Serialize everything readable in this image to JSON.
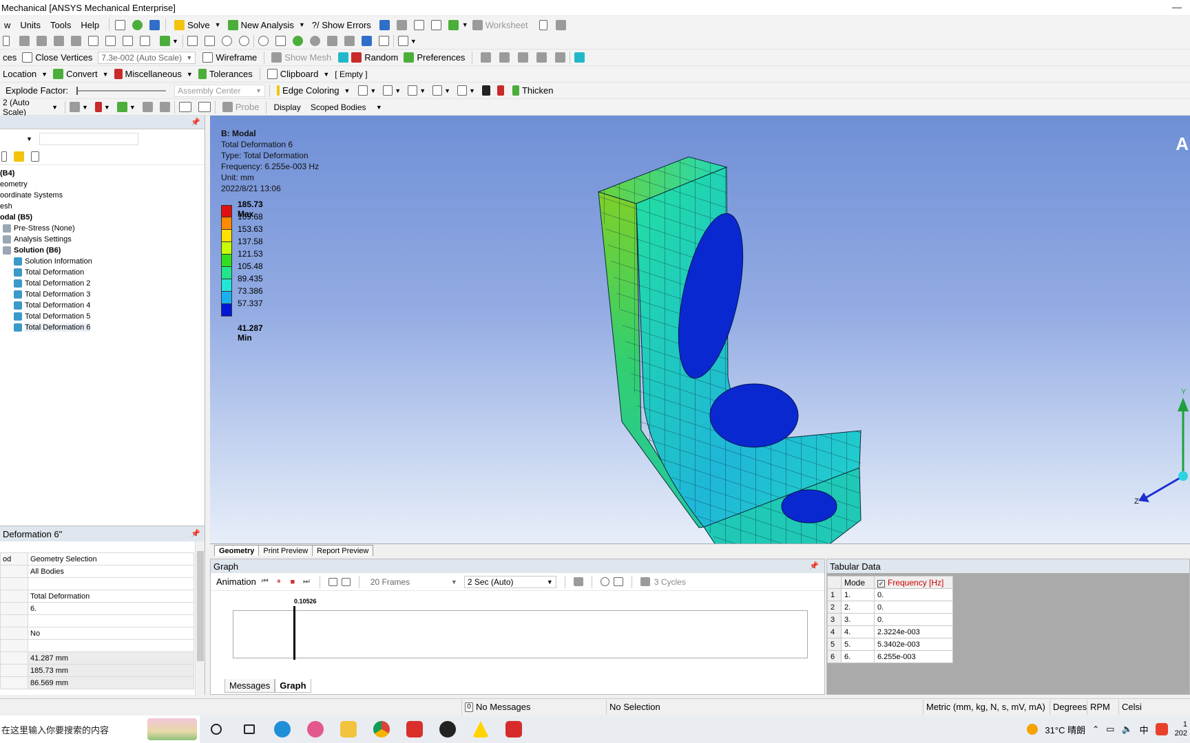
{
  "window": {
    "title": "Mechanical [ANSYS Mechanical Enterprise]",
    "minimize": "—"
  },
  "menu": {
    "items": [
      "w",
      "Units",
      "Tools",
      "Help"
    ],
    "solve": "Solve",
    "new_analysis": "New Analysis",
    "show_errors": "?/ Show Errors",
    "worksheet": "Worksheet"
  },
  "toolbar3": {
    "ces": "ces",
    "close_vertices": "Close Vertices",
    "scale": "7.3e-002 (Auto Scale)",
    "wireframe": "Wireframe",
    "show_mesh": "Show Mesh",
    "random": "Random",
    "preferences": "Preferences"
  },
  "toolbar4": {
    "location": "Location",
    "convert": "Convert",
    "miscellaneous": "Miscellaneous",
    "tolerances": "Tolerances",
    "clipboard": "Clipboard",
    "empty": "[ Empty ]"
  },
  "toolbar5": {
    "explode_factor": "Explode Factor:",
    "assembly_center": "Assembly Center",
    "edge_coloring": "Edge Coloring",
    "thicken": "Thicken"
  },
  "toolbar6": {
    "auto_scale": "2 (Auto Scale)",
    "probe": "Probe",
    "display": "Display",
    "scoped_bodies": "Scoped Bodies"
  },
  "tree": {
    "items": [
      {
        "label": "(B4)",
        "bold": true,
        "indent": 0
      },
      {
        "label": "eometry",
        "bold": false,
        "indent": 0
      },
      {
        "label": "oordinate Systems",
        "bold": false,
        "indent": 0
      },
      {
        "label": "esh",
        "bold": false,
        "indent": 0
      },
      {
        "label": "odal (B5)",
        "bold": true,
        "indent": 0
      },
      {
        "label": "Pre-Stress (None)",
        "bold": false,
        "indent": 1
      },
      {
        "label": "Analysis Settings",
        "bold": false,
        "indent": 1
      },
      {
        "label": "Solution (B6)",
        "bold": true,
        "indent": 1
      },
      {
        "label": "Solution Information",
        "bold": false,
        "indent": 2
      },
      {
        "label": "Total Deformation",
        "bold": false,
        "indent": 2
      },
      {
        "label": "Total Deformation 2",
        "bold": false,
        "indent": 2
      },
      {
        "label": "Total Deformation 3",
        "bold": false,
        "indent": 2
      },
      {
        "label": "Total Deformation 4",
        "bold": false,
        "indent": 2
      },
      {
        "label": "Total Deformation 5",
        "bold": false,
        "indent": 2
      },
      {
        "label": "Total Deformation 6",
        "bold": false,
        "indent": 2
      }
    ]
  },
  "details": {
    "title": "Deformation 6\"",
    "rows": [
      {
        "k": "od",
        "v": "Geometry Selection"
      },
      {
        "k": "",
        "v": "All Bodies"
      },
      {
        "k": "",
        "v": ""
      },
      {
        "k": "",
        "v": "Total Deformation"
      },
      {
        "k": "",
        "v": "6."
      },
      {
        "k": "",
        "v": ""
      },
      {
        "k": "",
        "v": "No"
      },
      {
        "k": "",
        "v": ""
      },
      {
        "k": "",
        "v": "41.287 mm"
      },
      {
        "k": "",
        "v": "185.73 mm"
      },
      {
        "k": "",
        "v": "86.569 mm"
      }
    ]
  },
  "viewport": {
    "system": "B: Modal",
    "result": "Total Deformation 6",
    "type": "Type: Total Deformation",
    "frequency": "Frequency: 6.255e-003 Hz",
    "unit": "Unit: mm",
    "date": "2022/8/21 13:06",
    "corner": "A",
    "axis_y": "Y",
    "axis_z": "Z",
    "legend": {
      "labels": [
        "185.73 Max",
        "169.68",
        "153.63",
        "137.58",
        "121.53",
        "105.48",
        "89.435",
        "73.386",
        "57.337",
        "41.287 Min"
      ],
      "colors": [
        "#e01010",
        "#ff8a00",
        "#ffe000",
        "#c8ff00",
        "#33dd22",
        "#22e68c",
        "#22e6d6",
        "#1ab0f0",
        "#1060f0",
        "#0018d8"
      ]
    }
  },
  "view_tabs": [
    "Geometry",
    "Print Preview",
    "Report Preview"
  ],
  "graph": {
    "title": "Graph",
    "animation": "Animation",
    "frames": "20 Frames",
    "duration": "2 Sec (Auto)",
    "cycles": "3 Cycles",
    "cursor_value": "0.10526",
    "tabs": [
      "Messages",
      "Graph"
    ]
  },
  "tabular": {
    "title": "Tabular Data",
    "headers": [
      "Mode",
      "Frequency [Hz]"
    ],
    "rows": [
      {
        "n": "1",
        "mode": "1.",
        "freq": "0."
      },
      {
        "n": "2",
        "mode": "2.",
        "freq": "0."
      },
      {
        "n": "3",
        "mode": "3.",
        "freq": "0."
      },
      {
        "n": "4",
        "mode": "4.",
        "freq": "2.3224e-003"
      },
      {
        "n": "5",
        "mode": "5.",
        "freq": "5.3402e-003"
      },
      {
        "n": "6",
        "mode": "6.",
        "freq": "6.255e-003"
      }
    ]
  },
  "status": {
    "messages": "No Messages",
    "messages_count": "0",
    "selection": "No Selection",
    "units": "Metric (mm, kg, N, s, mV, mA)",
    "degrees": "Degrees",
    "rpm": "RPM",
    "temp": "Celsi"
  },
  "taskbar": {
    "search_placeholder": "在这里输入你要搜索的内容",
    "weather": "31°C 晴朗",
    "ime": "中",
    "clock_top": "1",
    "clock_bottom": "202"
  }
}
